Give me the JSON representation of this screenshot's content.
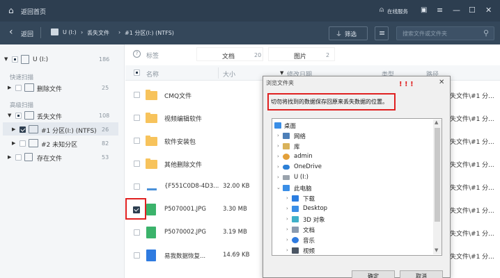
{
  "titlebar": {
    "back_home": "返回首页",
    "service": "在线服务",
    "window_controls": [
      "▣",
      "≡",
      "—",
      "☐",
      "✕"
    ]
  },
  "navbar": {
    "back": "返回",
    "crumbs": [
      "U (I:)",
      "丢失文件",
      "#1 分区(I:) (NTFS)"
    ],
    "filter": "筛选",
    "search_placeholder": "搜索文件或文件夹"
  },
  "sidebar": {
    "drive": {
      "label": "U (I:)",
      "count": "186"
    },
    "quick_scan_heading": "快速扫描",
    "deleted": {
      "label": "删除文件",
      "count": "25"
    },
    "deep_scan_heading": "高级扫描",
    "lost": {
      "label": "丢失文件",
      "count": "108"
    },
    "partition1": {
      "label": "#1 分区(I:) (NTFS)",
      "count": "26"
    },
    "partition2": {
      "label": "#2 未知分区",
      "count": "82"
    },
    "existing": {
      "label": "存在文件",
      "count": "53"
    }
  },
  "main": {
    "tags_label": "标签",
    "tab_docs": {
      "label": "文档",
      "count": "20"
    },
    "tab_pics": {
      "label": "图片",
      "count": "2"
    },
    "columns": {
      "name": "名称",
      "size": "大小",
      "modified": "修改日期",
      "type": "类型",
      "path": "路径"
    },
    "rows": [
      {
        "name": "CMQ文件",
        "size": "",
        "path": "失文件\\#1 分..."
      },
      {
        "name": "视频编辑软件",
        "size": "",
        "path": "失文件\\#1 分..."
      },
      {
        "name": "软件安装包",
        "size": "",
        "path": "失文件\\#1 分..."
      },
      {
        "name": "其他删除文件",
        "size": "",
        "path": "失文件\\#1 分..."
      },
      {
        "name": "{F551C0D8-4D3...",
        "size": "32.00 KB",
        "path": "失文件\\#1 分..."
      },
      {
        "name": "P5070001.JPG",
        "size": "3.30 MB",
        "path": "失文件\\#1 分..."
      },
      {
        "name": "P5070002.JPG",
        "size": "3.19 MB",
        "path": "失文件\\#1 分..."
      },
      {
        "name": "易我数据恢复...",
        "size": "14.69 KB",
        "path": "失文件\\#1 分..."
      }
    ]
  },
  "dialog": {
    "title": "浏览文件夹",
    "marks": "! ! !",
    "close": "✕",
    "instruction": "切勿将找到的数据保存回原来丢失数据的位置。",
    "tree": [
      "桌面",
      "网络",
      "库",
      "admin",
      "OneDrive",
      "U (I:)",
      "此电脑",
      "下载",
      "Desktop",
      "3D 对象",
      "文档",
      "音乐",
      "视频"
    ],
    "ok": "确定",
    "cancel": "取消"
  },
  "colors": {
    "titlebar": "#2d3e50",
    "navbar": "#34475a",
    "highlight": "#e02020",
    "folder": "#f7c35c"
  }
}
